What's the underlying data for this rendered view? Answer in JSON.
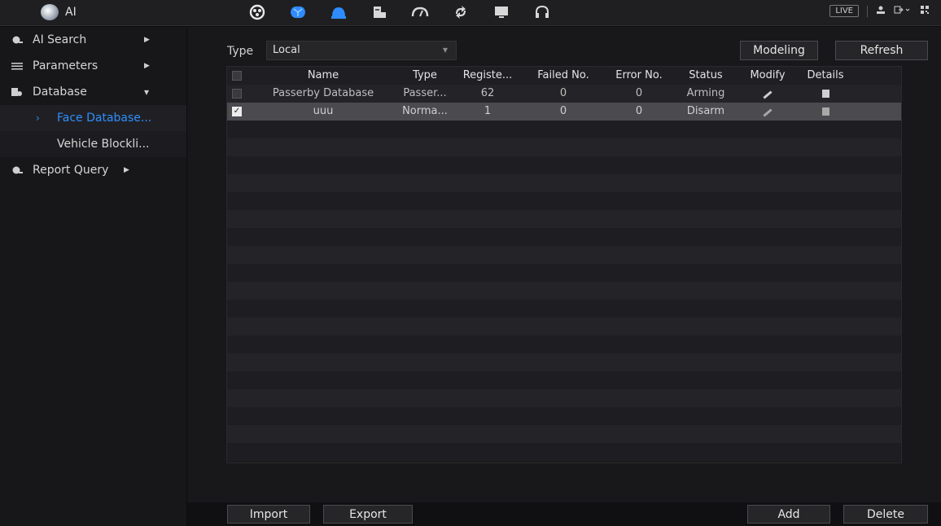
{
  "app": {
    "title": "AI"
  },
  "topbar": {
    "icons": [
      "main-menu-icon",
      "ai-icon",
      "user-icon",
      "storage-icon",
      "performance-icon",
      "maintenance-icon",
      "display-icon",
      "audio-icon"
    ],
    "live_label": "LIVE"
  },
  "sidebar": {
    "items": [
      {
        "label": "AI Search",
        "icon": "ai-search-icon"
      },
      {
        "label": "Parameters",
        "icon": "list-icon"
      },
      {
        "label": "Database",
        "icon": "database-icon"
      },
      {
        "label": "Report Query",
        "icon": "report-icon"
      }
    ],
    "sub_items": [
      {
        "label": "Face Database..."
      },
      {
        "label": "Vehicle Blockli..."
      }
    ]
  },
  "filter": {
    "type_label": "Type",
    "type_value": "Local"
  },
  "buttons": {
    "modeling": "Modeling",
    "refresh": "Refresh",
    "import": "Import",
    "export": "Export",
    "add": "Add",
    "delete": "Delete"
  },
  "table": {
    "headers": [
      "Name",
      "Type",
      "Registe...",
      "Failed No.",
      "Error No.",
      "Status",
      "Modify",
      "Details"
    ],
    "rows": [
      {
        "name": "Passerby Database",
        "type": "Passer...",
        "registered": "62",
        "failed": "0",
        "error": "0",
        "status": "Arming",
        "checked": false
      },
      {
        "name": "uuu",
        "type": "Norma...",
        "registered": "1",
        "failed": "0",
        "error": "0",
        "status": "Disarm",
        "checked": true
      }
    ]
  },
  "colors": {
    "accent": "#2e8fff",
    "panel": "#18181b",
    "selected_row": "#4a4a4f"
  }
}
